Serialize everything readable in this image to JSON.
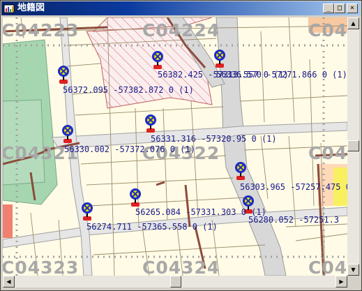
{
  "window": {
    "title": "地籍図",
    "minimize_glyph": "_",
    "maximize_glyph": "□",
    "close_glyph": "×"
  },
  "map": {
    "sheet_labels": [
      "C04223",
      "C04224",
      "C0422",
      "C04321",
      "C04322",
      "C0432",
      "C04323",
      "C04324",
      "C0432"
    ],
    "points": [
      {
        "label": "56382.425 -57313.557 0 (1)",
        "color": "#2a2adc"
      },
      {
        "label": "56336.570 -57271.866 0 (1)",
        "color": "#2a2adc"
      },
      {
        "label": "56372.095 -57382.872 0 (1)",
        "color": "#2a2adc"
      },
      {
        "label": "56331.316 -57320.95 0 (1)",
        "color": "#2a2adc"
      },
      {
        "label": "56330.002 -57372.076 0 (1)",
        "color": "#2a2adc"
      },
      {
        "label": "56303.965 -57257.475 0 (1)",
        "color": "#2a2adc"
      },
      {
        "label": "56265.084 -57331.303 0 (1)",
        "color": "#2a2adc"
      },
      {
        "label": "56280.052 -57251.3",
        "color": "#2a2adc"
      },
      {
        "label": "56274.711 -57365.558 0 (1)",
        "color": "#2a2adc"
      }
    ]
  },
  "scrollbars": {
    "up_glyph": "▲",
    "down_glyph": "▼",
    "left_glyph": "◀",
    "right_glyph": "▶"
  },
  "colors": {
    "road": "#d8d8d8",
    "parcel_line": "#8c4c3c",
    "green_area": "#a6d6b0",
    "hatched_area": "#f6dede",
    "sheet_grid": "#a0a0a0",
    "label_text": "#1a1a8c"
  }
}
